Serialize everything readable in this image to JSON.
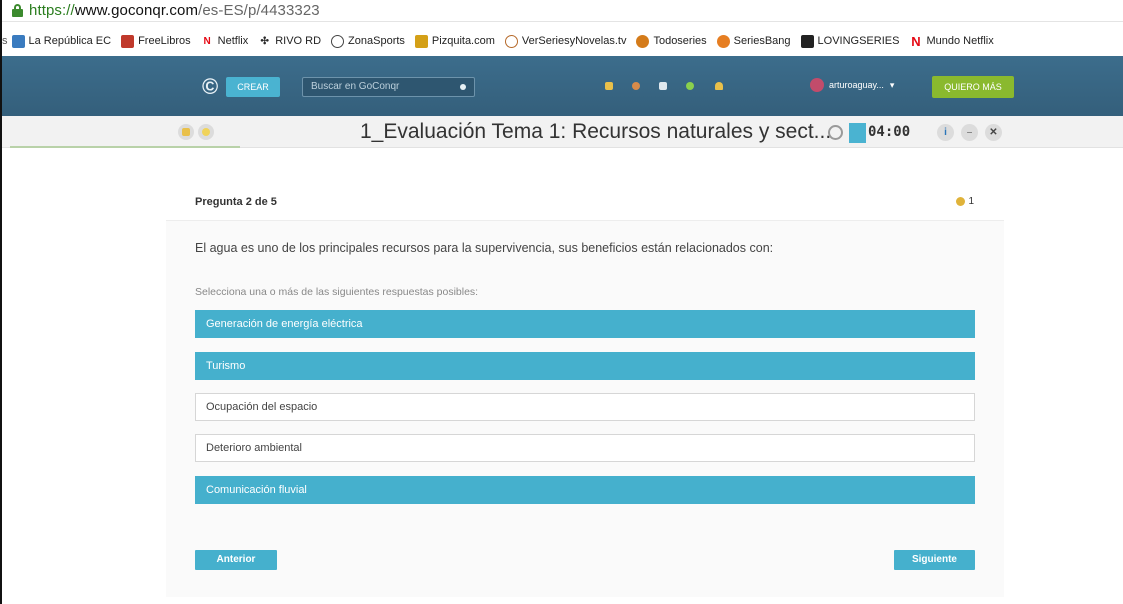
{
  "browser": {
    "url_protocol": "https://",
    "url_domain": "www.goconqr.com",
    "url_path": "/es-ES/p/4433323",
    "bookmarks": [
      {
        "label": "La República EC",
        "icon": "rp-icon",
        "color": "#3a7bbf"
      },
      {
        "label": "FreeLibros",
        "icon": "book-icon",
        "color": "#c0392b"
      },
      {
        "label": "Netflix",
        "icon": "netflix-icon",
        "color": "#e50914"
      },
      {
        "label": "RIVO RD",
        "icon": "rivo-icon",
        "color": "#2a2a2a"
      },
      {
        "label": "ZonaSports",
        "icon": "ball-icon",
        "color": "#444444"
      },
      {
        "label": "Pizquita.com",
        "icon": "pizquita-icon",
        "color": "#d4a017"
      },
      {
        "label": "VerSeriesyNovelas.tv",
        "icon": "tv-icon",
        "color": "#b66a2b"
      },
      {
        "label": "Todoseries",
        "icon": "todoseries-icon",
        "color": "#d47b1a"
      },
      {
        "label": "SeriesBang",
        "icon": "seriesbang-icon",
        "color": "#e67e22"
      },
      {
        "label": "LOVINGSERIES",
        "icon": "lovingseries-icon",
        "color": "#222222"
      },
      {
        "label": "Mundo Netflix",
        "icon": "netflix-icon",
        "color": "#e50914"
      }
    ]
  },
  "header": {
    "create_label": "CREAR",
    "search_placeholder": "Buscar en GoConqr",
    "username": "arturoaguay...",
    "upgrade_label": "QUIERO MÁS"
  },
  "quiz": {
    "title": "1_Evaluación Tema 1: Recursos naturales y sect...",
    "timer": "04:00"
  },
  "question": {
    "counter": "Pregunta 2 de 5",
    "flag_count": "1",
    "text": "El agua es uno de los principales recursos para la supervivencia, sus beneficios están relacionados con:",
    "hint": "Selecciona una o más de las siguientes respuestas posibles:",
    "options": [
      {
        "label": "Generación de energía eléctrica",
        "selected": true
      },
      {
        "label": "Turismo",
        "selected": true
      },
      {
        "label": "Ocupación del espacio",
        "selected": false
      },
      {
        "label": "Deterioro ambiental",
        "selected": false
      },
      {
        "label": "Comunicación fluvial",
        "selected": true
      }
    ],
    "prev_label": "Anterior",
    "next_label": "Siguiente"
  },
  "colors": {
    "accent": "#45b0cd",
    "header_bg": "#3c6d8c",
    "upgrade": "#8ab92e"
  }
}
